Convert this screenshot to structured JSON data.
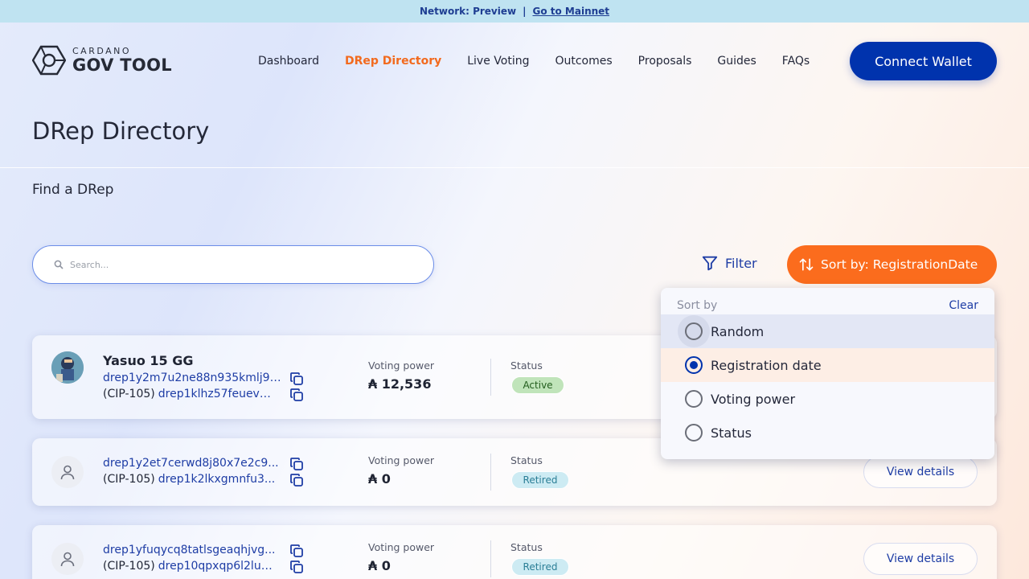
{
  "banner": {
    "network": "Network: Preview",
    "separator": "|",
    "link": "Go to Mainnet"
  },
  "logo": {
    "small": "CARDANO",
    "big": "GOV TOOL"
  },
  "nav": {
    "items": [
      "Dashboard",
      "DRep Directory",
      "Live Voting",
      "Outcomes",
      "Proposals",
      "Guides",
      "FAQs"
    ],
    "active": "DRep Directory",
    "connect": "Connect Wallet"
  },
  "page": {
    "title": "DRep Directory",
    "find_label": "Find a DRep"
  },
  "search": {
    "placeholder": "Search...",
    "value": ""
  },
  "controls": {
    "filter": "Filter",
    "sort": "Sort by: RegistrationDate"
  },
  "sort_menu": {
    "header": "Sort by",
    "clear": "Clear",
    "options": [
      "Random",
      "Registration date",
      "Voting power",
      "Status"
    ],
    "selected": "Registration date",
    "hovered": "Random"
  },
  "dreps": [
    {
      "name": "Yasuo 15 GG",
      "id": "drep1y2m7u2ne88n935kmlj9z...",
      "cip_prefix": "(CIP-105)",
      "cip_id": "drep1klhz57feuevd...",
      "vp_label": "Voting power",
      "vp": "₳ 12,536",
      "status_label": "Status",
      "status": "Active",
      "avatar": "photo"
    },
    {
      "name": "",
      "id": "drep1y2et7cerwd8j80x7e2c9...",
      "cip_prefix": "(CIP-105)",
      "cip_id": "drep1k2lkxgmnfu3...",
      "vp_label": "Voting power",
      "vp": "₳ 0",
      "status_label": "Status",
      "status": "Retired",
      "view": "View details",
      "avatar": "person-icon"
    },
    {
      "name": "",
      "id": "drep1yfuqycq8tatlsgeaqhjvg...",
      "cip_prefix": "(CIP-105)",
      "cip_id": "drep10qpxqp6l2luz...",
      "vp_label": "Voting power",
      "vp": "₳ 0",
      "status_label": "Status",
      "status": "Retired",
      "view": "View details",
      "avatar": "person-icon"
    }
  ],
  "colors": {
    "brand_blue": "#0033ad",
    "accent_orange": "#fb6c1d",
    "banner": "#bfe3f1"
  }
}
